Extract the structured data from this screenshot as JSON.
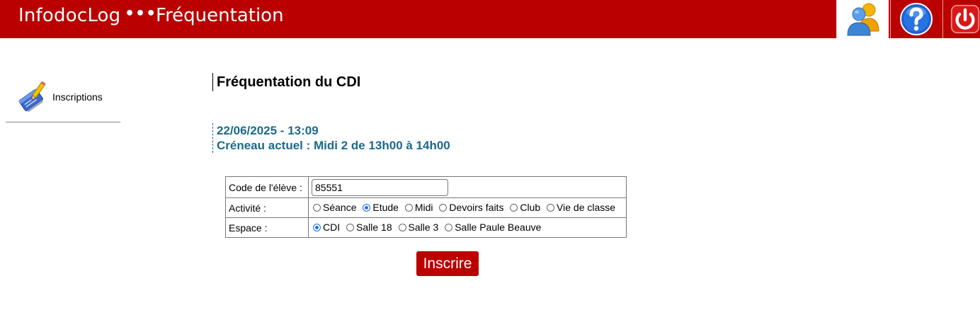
{
  "header": {
    "app_name": "InfodocLog",
    "separator": "•••",
    "section": "Fréquentation",
    "buttons": [
      {
        "icon": "users-icon"
      },
      {
        "icon": "help-icon"
      },
      {
        "icon": "power-icon"
      }
    ]
  },
  "sidebar": {
    "items": [
      {
        "label": "Inscriptions",
        "icon": "register-pen-icon"
      }
    ]
  },
  "main": {
    "title": "Fréquentation du CDI",
    "datetime": "22/06/2025 - 13:09",
    "slot": "Créneau actuel : Midi 2 de 13h00 à 14h00"
  },
  "form": {
    "code_label": "Code de l'élève :",
    "code_value": "85551",
    "activity_label": "Activité :",
    "activities": [
      {
        "label": "Séance",
        "checked": false
      },
      {
        "label": "Etude",
        "checked": true
      },
      {
        "label": "Midi",
        "checked": false
      },
      {
        "label": "Devoirs faits",
        "checked": false
      },
      {
        "label": "Club",
        "checked": false
      },
      {
        "label": "Vie de classe",
        "checked": false
      }
    ],
    "space_label": "Espace :",
    "spaces": [
      {
        "label": "CDI",
        "checked": true
      },
      {
        "label": "Salle 18",
        "checked": false
      },
      {
        "label": "Salle 3",
        "checked": false
      },
      {
        "label": "Salle Paule Beauve",
        "checked": false
      }
    ],
    "submit_label": "Inscrire"
  },
  "colors": {
    "header_bg": "#bb0000",
    "info_text": "#1a6b8a",
    "radio_checked": "#1a73e8"
  }
}
